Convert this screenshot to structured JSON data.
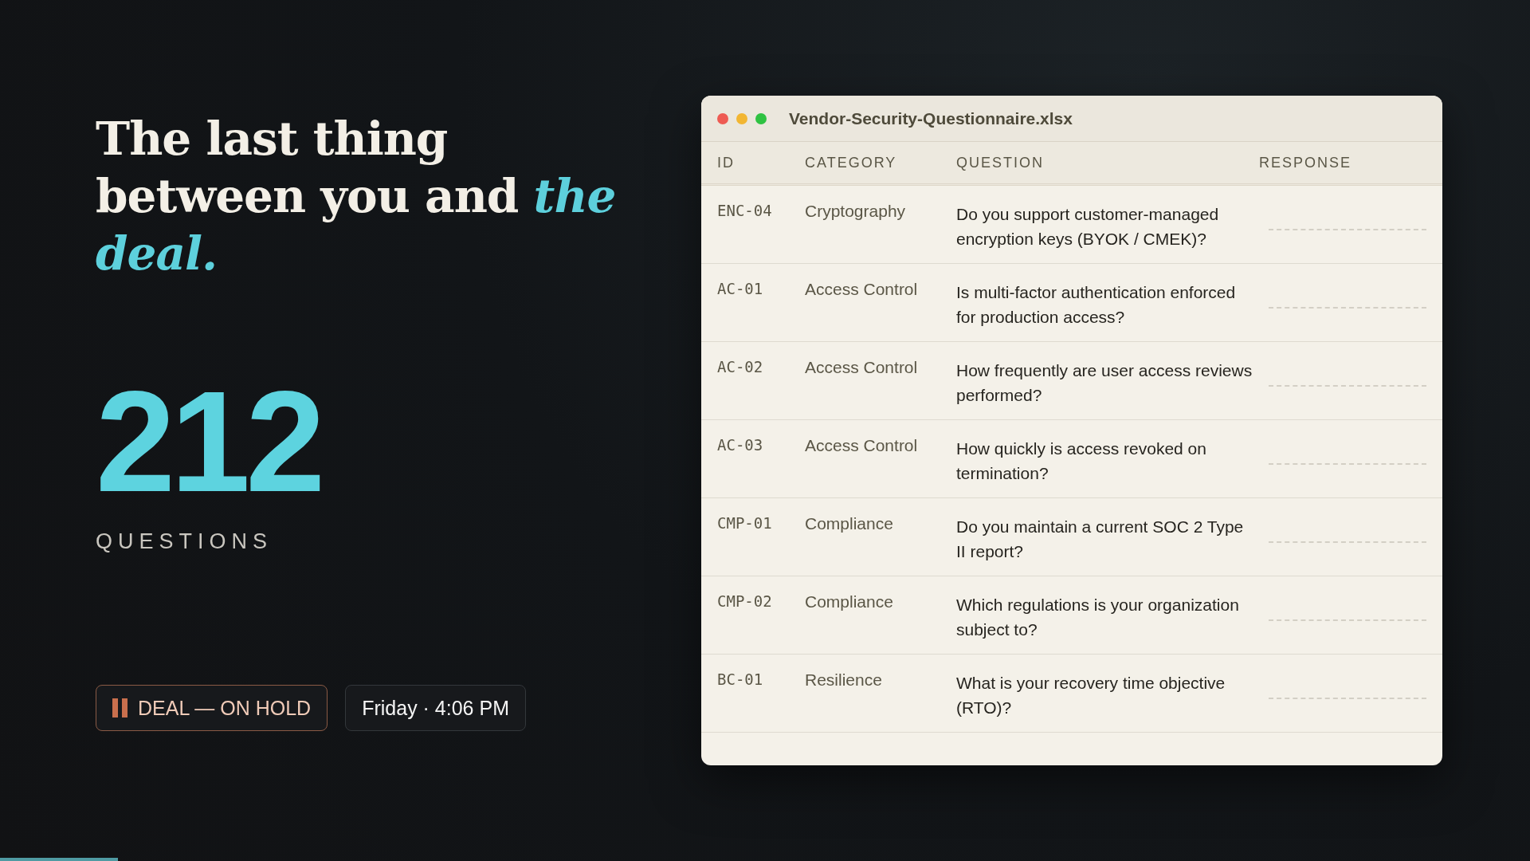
{
  "headline": {
    "lead": "The last thing between you and",
    "emphasis": "the deal."
  },
  "stat": {
    "value": "212",
    "label": "QUESTIONS"
  },
  "badges": [
    {
      "kind": "status",
      "label": "DEAL — ON HOLD"
    },
    {
      "kind": "time",
      "label": "Friday · 4:06 PM"
    }
  ],
  "window": {
    "title": "Vendor-Security-Questionnaire.xlsx",
    "columns": [
      "ID",
      "CATEGORY",
      "QUESTION",
      "RESPONSE"
    ],
    "rows": [
      {
        "id": "ENC-04",
        "category": "Cryptography",
        "question": "Do you support customer-managed encryption keys (BYOK / CMEK)?"
      },
      {
        "id": "AC-01",
        "category": "Access Control",
        "question": "Is multi-factor authentication enforced for production access?"
      },
      {
        "id": "AC-02",
        "category": "Access Control",
        "question": "How frequently are user access reviews performed?"
      },
      {
        "id": "AC-03",
        "category": "Access Control",
        "question": "How quickly is access revoked on termination?"
      },
      {
        "id": "CMP-01",
        "category": "Compliance",
        "question": "Do you maintain a current SOC 2 Type II report?"
      },
      {
        "id": "CMP-02",
        "category": "Compliance",
        "question": "Which regulations is your organization subject to?"
      },
      {
        "id": "BC-01",
        "category": "Resilience",
        "question": "What is your recovery time objective (RTO)?"
      }
    ]
  },
  "progress": {
    "level": 0.077
  }
}
